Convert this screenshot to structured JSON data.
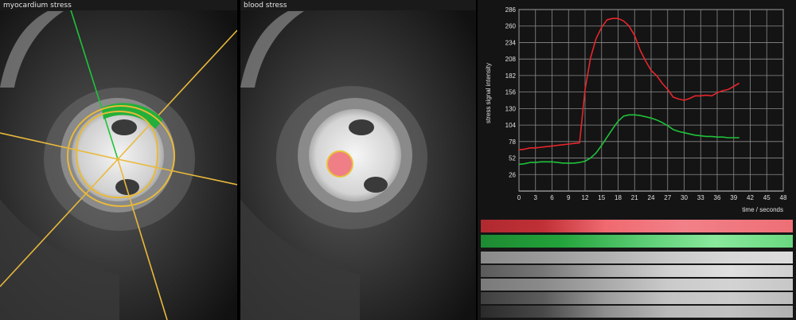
{
  "panels": {
    "left": {
      "title": "myocardium stress"
    },
    "middle": {
      "title": "blood stress"
    }
  },
  "colors": {
    "segment_line": "#e8b93a",
    "highlight_sector": "#22b03a",
    "green_ray": "#1ec43a",
    "blood_roi_fill": "#f07e86",
    "blood_roi_stroke": "#e8c23a",
    "red_curve": "#e6262b",
    "green_curve": "#1fc23a",
    "grid": "#8a8a8a"
  },
  "chart_data": {
    "type": "line",
    "ylabel": "stress signal intensity",
    "xlabel": "time / seconds",
    "xlim": [
      0,
      48
    ],
    "ylim": [
      0,
      286
    ],
    "xticks": [
      0,
      3,
      6,
      9,
      12,
      15,
      18,
      21,
      24,
      27,
      30,
      33,
      36,
      39,
      42,
      45,
      48
    ],
    "yticks": [
      26,
      52,
      78,
      104,
      130,
      156,
      182,
      208,
      234,
      260,
      286
    ],
    "grid": true,
    "series": [
      {
        "color": "#e6262b",
        "x": [
          0,
          1,
          2,
          3,
          4,
          5,
          6,
          7,
          8,
          9,
          10,
          11,
          12,
          13,
          14,
          15,
          16,
          17,
          18,
          19,
          20,
          21,
          22,
          23,
          24,
          25,
          26,
          27,
          28,
          29,
          30,
          31,
          32,
          33,
          34,
          35,
          36,
          37,
          38,
          39,
          40
        ],
        "y": [
          65,
          66,
          68,
          68,
          69,
          70,
          71,
          72,
          73,
          74,
          75,
          76,
          160,
          210,
          240,
          258,
          270,
          272,
          272,
          268,
          260,
          245,
          222,
          205,
          190,
          182,
          170,
          160,
          148,
          145,
          143,
          146,
          150,
          150,
          151,
          150,
          155,
          158,
          160,
          165,
          170
        ]
      },
      {
        "color": "#1fc23a",
        "x": [
          0,
          1,
          2,
          3,
          4,
          5,
          6,
          7,
          8,
          9,
          10,
          11,
          12,
          13,
          14,
          15,
          16,
          17,
          18,
          19,
          20,
          21,
          22,
          23,
          24,
          25,
          26,
          27,
          28,
          29,
          30,
          31,
          32,
          33,
          34,
          35,
          36,
          37,
          38,
          39,
          40
        ],
        "y": [
          42,
          43,
          45,
          45,
          46,
          46,
          46,
          45,
          44,
          44,
          44,
          45,
          47,
          52,
          60,
          72,
          85,
          98,
          110,
          118,
          120,
          120,
          119,
          117,
          115,
          112,
          108,
          103,
          97,
          94,
          92,
          90,
          88,
          87,
          86,
          86,
          85,
          85,
          84,
          84,
          84
        ]
      }
    ]
  },
  "strips": {
    "gray_rows": [
      [
        "#8a8a8a",
        "#9a9a9a",
        "#b0b0b0",
        "#c8c8c8",
        "#d8d8d8",
        "#dcdcdc"
      ],
      [
        "#5a5a5a",
        "#777777",
        "#aaaaaa",
        "#d0d0d0",
        "#e0e0e0",
        "#cfcfcf"
      ],
      [
        "#7a7a7a",
        "#8a8a8a",
        "#a9a9a9",
        "#cacaca",
        "#d3d3d3",
        "#c7c7c7"
      ],
      [
        "#404040",
        "#5c5c5c",
        "#9c9c9c",
        "#c3c3c3",
        "#cbcbcb",
        "#bcbcbc"
      ],
      [
        "#2a2a2a",
        "#484848",
        "#8e8e8e",
        "#b8b8b8",
        "#c0c0c0",
        "#b0b0b0"
      ]
    ]
  }
}
